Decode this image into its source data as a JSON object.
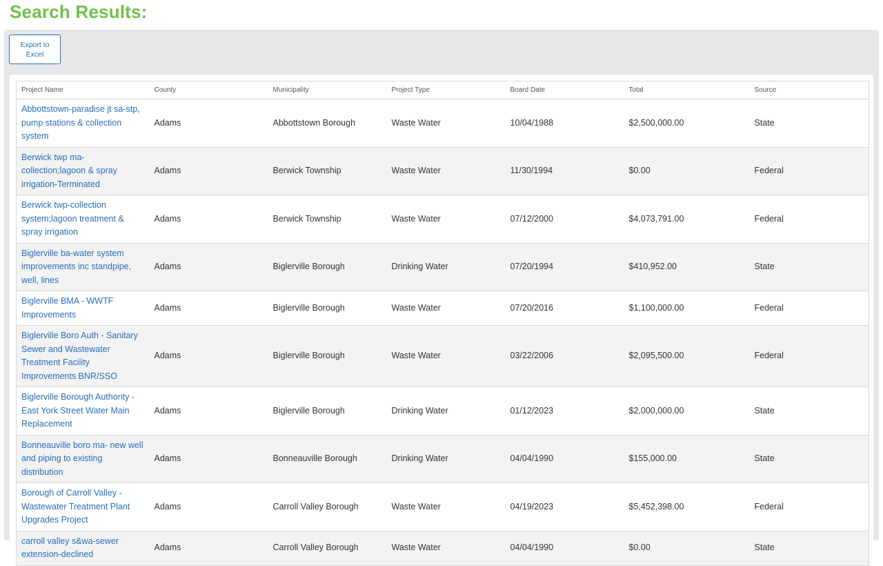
{
  "page": {
    "title": "Search Results:"
  },
  "toolbar": {
    "export_label": "Export to Excel"
  },
  "table": {
    "columns": [
      "Project Name",
      "County",
      "Municipality",
      "Project Type",
      "Board Date",
      "Total",
      "Source"
    ],
    "rows": [
      [
        "Abbottstown-paradise jt sa-stp, pump stations & collection system",
        "Adams",
        "Abbottstown Borough",
        "Waste Water",
        "10/04/1988",
        "$2,500,000.00",
        "State"
      ],
      [
        "Berwick twp ma-collection;lagoon & spray irrigation-Terminated",
        "Adams",
        "Berwick Township",
        "Waste Water",
        "11/30/1994",
        "$0.00",
        "Federal"
      ],
      [
        "Berwick twp-collection system;lagoon treatment & spray irrigation",
        "Adams",
        "Berwick Township",
        "Waste Water",
        "07/12/2000",
        "$4,073,791.00",
        "Federal"
      ],
      [
        "Biglerville ba-water system improvements inc standpipe, well, lines",
        "Adams",
        "Biglerville Borough",
        "Drinking Water",
        "07/20/1994",
        "$410,952.00",
        "State"
      ],
      [
        "Biglerville BMA - WWTF Improvements",
        "Adams",
        "Biglerville Borough",
        "Waste Water",
        "07/20/2016",
        "$1,100,000.00",
        "Federal"
      ],
      [
        "Biglerville Boro Auth - Sanitary Sewer and Wastewater Treatment Facility Improvements BNR/SSO",
        "Adams",
        "Biglerville Borough",
        "Waste Water",
        "03/22/2006",
        "$2,095,500.00",
        "Federal"
      ],
      [
        "Biglerville Borough Authority - East York Street Water Main Replacement",
        "Adams",
        "Biglerville Borough",
        "Drinking Water",
        "01/12/2023",
        "$2,000,000.00",
        "State"
      ],
      [
        "Bonneauville boro ma- new well and piping to existing distribution",
        "Adams",
        "Bonneauville Borough",
        "Drinking Water",
        "04/04/1990",
        "$155,000.00",
        "State"
      ],
      [
        "Borough of Carroll Valley - Wastewater Treatment Plant Upgrades Project",
        "Adams",
        "Carroll Valley Borough",
        "Waste Water",
        "04/19/2023",
        "$5,452,398.00",
        "Federal"
      ],
      [
        "carroll valley s&wa-sewer extension-declined",
        "Adams",
        "Carroll Valley Borough",
        "Waste Water",
        "04/04/1990",
        "$0.00",
        "State"
      ]
    ]
  }
}
